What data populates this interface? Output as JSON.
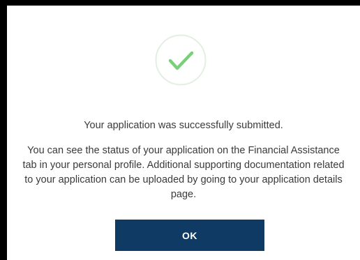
{
  "dialog": {
    "icon": "check-circle-icon",
    "headline": "Your application was successfully submitted.",
    "message": "You can see the status of your application on the Financial Assistance tab in your personal profile. Additional supporting documentation related to your application can be uploaded by going to your application details page.",
    "ok_label": "OK"
  },
  "colors": {
    "check": "#7ad07a",
    "circle_border": "#e2efe2",
    "button_bg": "#0f3a63",
    "text": "#3a3a3a"
  }
}
